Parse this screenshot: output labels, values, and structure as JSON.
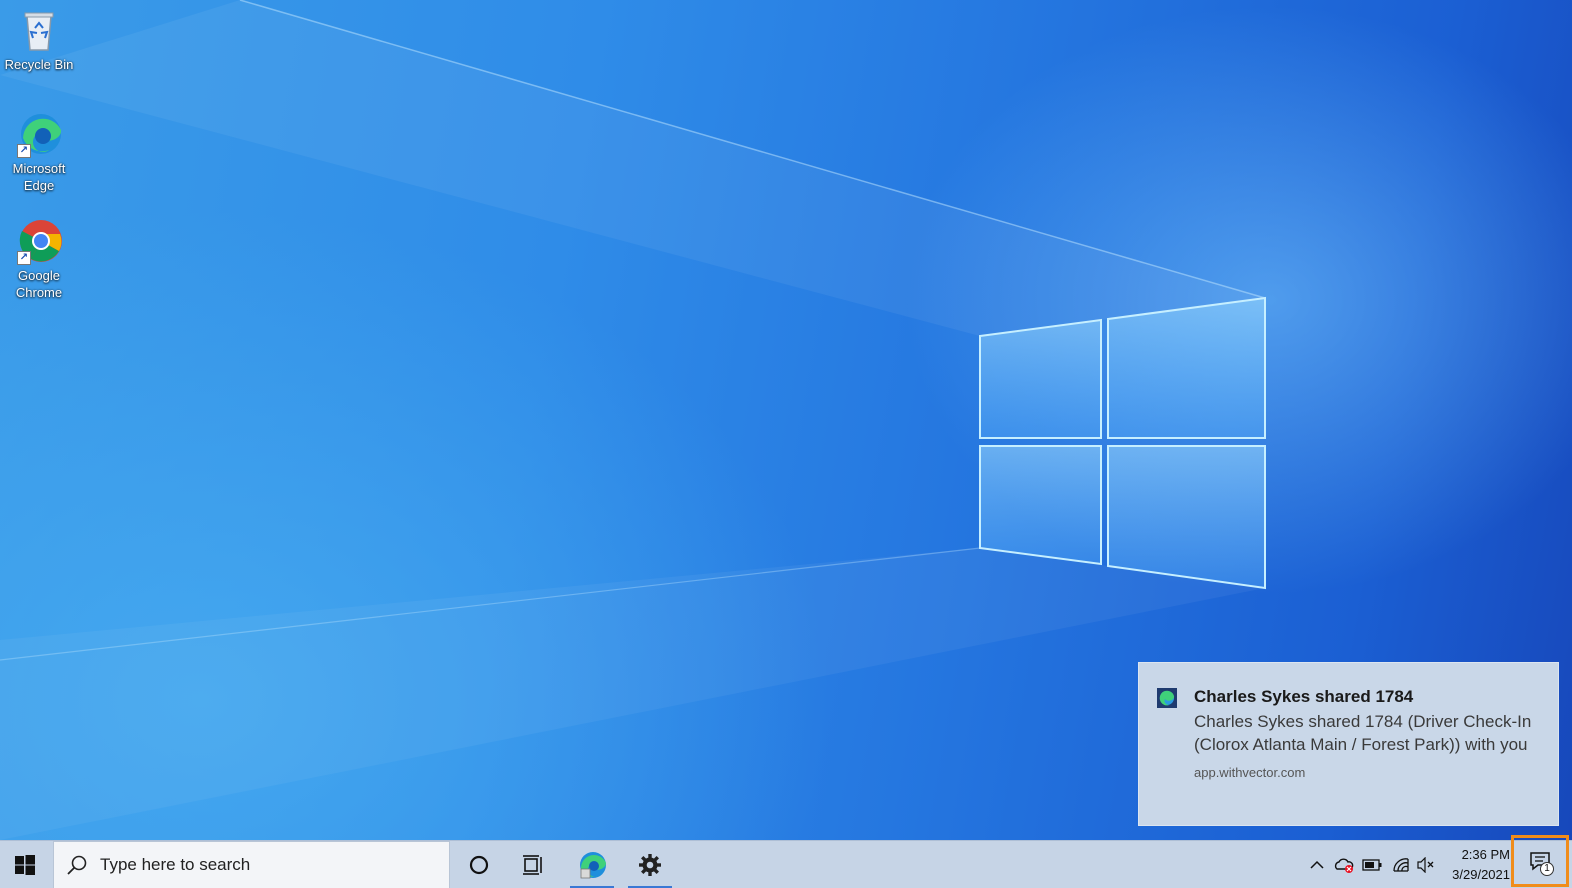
{
  "desktop": {
    "icons": [
      {
        "label": "Recycle Bin"
      },
      {
        "label": "Microsoft Edge"
      },
      {
        "label": "Google Chrome"
      }
    ]
  },
  "notification": {
    "title": "Charles Sykes shared 1784",
    "body": "Charles Sykes shared 1784 (Driver Check-In (Clorox Atlanta Main / Forest Park)) with you",
    "source": "app.withvector.com"
  },
  "taskbar": {
    "search_placeholder": "Type here to search",
    "clock_time": "2:36 PM",
    "clock_date": "3/29/2021",
    "notification_count": "1"
  },
  "colors": {
    "taskbar_bg": "#c6d4e6",
    "toast_bg": "#c9d7e8",
    "highlight": "#f08c1a",
    "accent": "#3a78d4"
  },
  "icons": [
    "windows-logo-icon",
    "search-icon",
    "cortana-icon",
    "task-view-icon",
    "edge-icon",
    "gear-icon",
    "chevron-up-icon",
    "onedrive-error-icon",
    "battery-icon",
    "network-icon",
    "volume-muted-icon",
    "action-center-icon"
  ]
}
